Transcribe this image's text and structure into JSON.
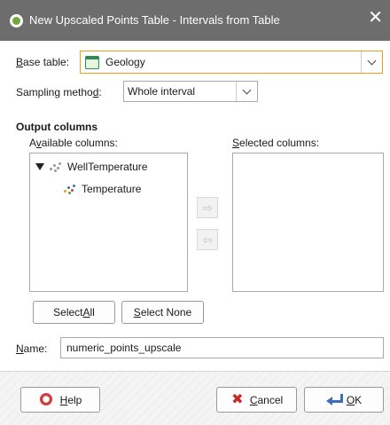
{
  "window": {
    "title": "New Upscaled Points Table - Intervals from Table",
    "close_glyph": "✕"
  },
  "base_table": {
    "label": "Base table:",
    "value": "Geology",
    "icon": "table-icon"
  },
  "sampling": {
    "label": "Sampling method:",
    "value": "Whole interval"
  },
  "output": {
    "section_title": "Output columns",
    "available_label": "Available columns:",
    "selected_label": "Selected columns:",
    "tree": {
      "parent": "WellTemperature",
      "child": "Temperature"
    },
    "add_arrow": "⇨",
    "remove_arrow": "⇦",
    "select_all_label": "Select All",
    "select_none_label": "Select None"
  },
  "name": {
    "label": "Name:",
    "value": "numeric_points_upscale"
  },
  "footer": {
    "help_label": "Help",
    "cancel_label": "Cancel",
    "ok_label": "OK"
  },
  "colors": {
    "titlebar": "#6d6d6d",
    "accent_orange": "#e8a020",
    "help_red": "#d53a3a",
    "ok_blue": "#3d6fb6"
  }
}
